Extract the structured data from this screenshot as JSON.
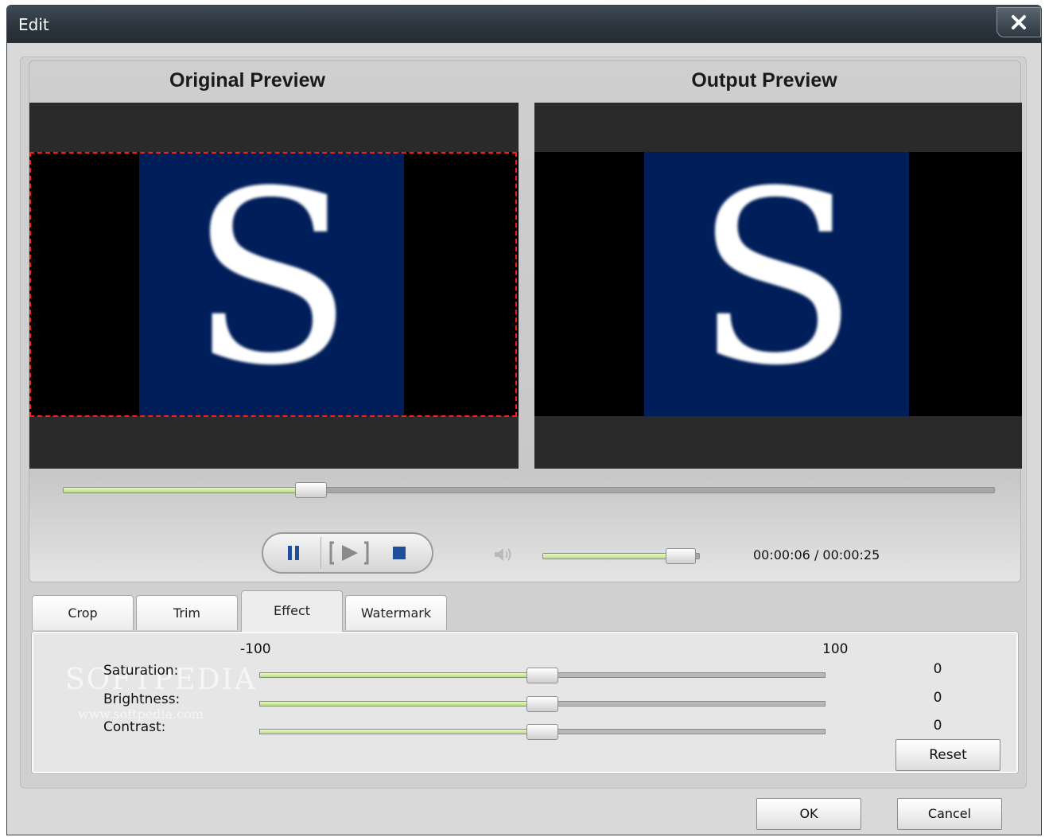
{
  "window": {
    "title": "Edit"
  },
  "preview": {
    "original_title": "Original Preview",
    "output_title": "Output Preview",
    "video_letter": "S",
    "seek_progress": 0.25
  },
  "player": {
    "pause_icon": "pause-icon",
    "play_icon": "play-frame-icon",
    "stop_icon": "stop-icon",
    "volume_icon": "speaker-icon",
    "volume_level": 0.88,
    "time": "00:00:06 / 00:00:25"
  },
  "tabs": [
    {
      "label": "Crop",
      "active": false
    },
    {
      "label": "Trim",
      "active": false
    },
    {
      "label": "Effect",
      "active": true
    },
    {
      "label": "Watermark",
      "active": false
    }
  ],
  "effect": {
    "min_label": "-100",
    "max_label": "100",
    "rows": [
      {
        "label": "Saturation:",
        "value": "0"
      },
      {
        "label": "Brightness:",
        "value": "0"
      },
      {
        "label": "Contrast:",
        "value": "0"
      }
    ],
    "reset_label": "Reset",
    "watermark_text": "SOFTPEDIA",
    "watermark_url": "www.softpedia.com"
  },
  "footer": {
    "ok_label": "OK",
    "cancel_label": "Cancel"
  },
  "colors": {
    "accent_fill": "#b8de84",
    "crop_border": "#ff1a1a",
    "video_bg": "#001f5a"
  }
}
